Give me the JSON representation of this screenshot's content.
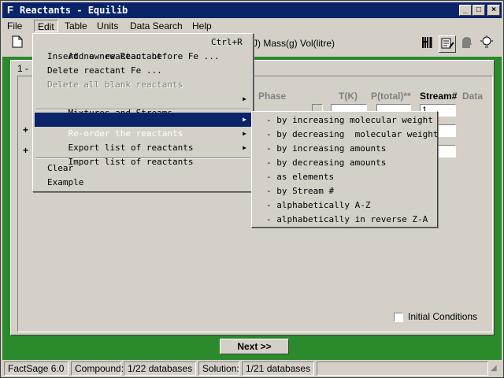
{
  "window": {
    "icon": "F",
    "title": "Reactants - Equilib",
    "buttons": [
      "minimize",
      "maximize",
      "close"
    ]
  },
  "menubar": [
    "File",
    "Edit",
    "Table",
    "Units",
    "Data Search",
    "Help"
  ],
  "toolbar": {
    "units_text_visible": "J)  Mass(g)  Vol(litre)",
    "icons": [
      "new-document-icon",
      "fork-knife-icon",
      "list-pencil-icon",
      "head-icon",
      "lightbulb-icon"
    ]
  },
  "tab": {
    "label": "1 -"
  },
  "table": {
    "headers": [
      "Phase",
      "T(K)",
      "P(total)**",
      "Stream#",
      "Data"
    ],
    "stream_first_value": "1",
    "plus_signs": [
      "+",
      "+"
    ]
  },
  "edit_menu": {
    "items": [
      {
        "label": "Add a new Reactant",
        "shortcut": "Ctrl+R"
      },
      {
        "label": "Insert new reactant before Fe ..."
      },
      {
        "label": "Delete reactant Fe ..."
      },
      {
        "label": "Delete all blank reactants",
        "disabled": true
      },
      {
        "label": "Mixtures and Streams",
        "submenu": true
      },
      {
        "label": "Re-order the reactants",
        "submenu": true,
        "highlighted": true
      },
      {
        "label": "Export list of reactants",
        "submenu": true
      },
      {
        "label": "Import list of reactants",
        "submenu": true
      },
      {
        "label": "Clear"
      },
      {
        "label": "Example"
      }
    ]
  },
  "reorder_submenu": [
    "- by increasing molecular weight",
    "- by decreasing  molecular weight",
    "- by increasing amounts",
    "- by decreasing amounts",
    "- as elements",
    "- by Stream #",
    "- alphabetically A-Z",
    "- alphabetically in reverse Z-A"
  ],
  "initial_conditions": {
    "label": "Initial Conditions",
    "checked": false
  },
  "next_button": "Next >>",
  "statusbar": {
    "app": "FactSage 6.0",
    "compound_label": "Compound:",
    "compound_value": "1/22 databases",
    "solution_label": "Solution:",
    "solution_value": "1/21 databases"
  }
}
